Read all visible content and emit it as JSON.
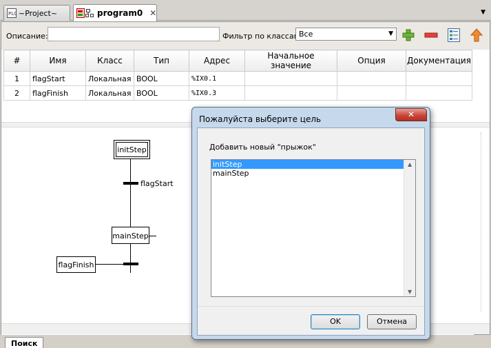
{
  "tabs": [
    {
      "label": "~Project~",
      "icon": "plc-project-icon",
      "active": false
    },
    {
      "label": "program0",
      "icon": "sfc-program-icon",
      "active": true,
      "close": "✕"
    }
  ],
  "toolbar": {
    "description_label": "Описание:",
    "description_value": "",
    "filter_label": "Фильтр по классам:",
    "filter_value": "Все",
    "buttons": [
      "add-icon",
      "remove-icon",
      "edit-list-icon",
      "move-up-icon"
    ]
  },
  "variables": {
    "columns": [
      "#",
      "Имя",
      "Класс",
      "Тип",
      "Адрес",
      "Начальное значение",
      "Опция",
      "Документация"
    ],
    "rows": [
      [
        "1",
        "flagStart",
        "Локальная",
        "BOOL",
        "%IX0.1",
        "",
        "",
        ""
      ],
      [
        "2",
        "flagFinish",
        "Локальная",
        "BOOL",
        "%IX0.3",
        "",
        "",
        ""
      ]
    ]
  },
  "diagram": {
    "steps": [
      "initStep",
      "mainStep"
    ],
    "transitions": [
      "flagStart",
      "flagFinish"
    ]
  },
  "bottom_tab": "Поиск",
  "dialog": {
    "title": "Пожалуйста выберите цель",
    "close": "✕",
    "prompt": "Добавить новый \"прыжок\"",
    "items": [
      "initStep",
      "mainStep"
    ],
    "selected": "initStep",
    "ok": "OK",
    "cancel": "Отмена"
  },
  "colors": {
    "selection": "#3399ff",
    "dialog_frame": "#c6d8ec",
    "close_button": "#c7483a"
  }
}
